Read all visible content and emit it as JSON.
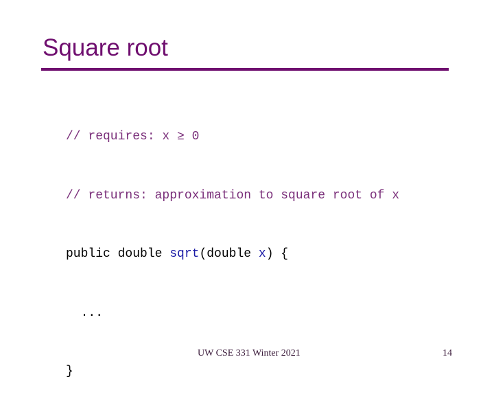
{
  "slide": {
    "title": "Square root",
    "code_lines": [
      {
        "comment": "// requires: x ≥ 0"
      },
      {
        "comment": "// returns: approximation to square root of x"
      },
      {
        "kw": "public double ",
        "fn": "sqrt",
        "mid": "(double ",
        "param": "x",
        "tail": ") {"
      },
      {
        "plain": "  ..."
      },
      {
        "plain": "}"
      }
    ],
    "footer": {
      "course": "UW CSE 331 Winter 2021",
      "page_number": "14"
    },
    "colors": {
      "accent": "#6f0f6f",
      "comment": "#7a2f7a",
      "identifier": "#1a1aa6"
    }
  }
}
